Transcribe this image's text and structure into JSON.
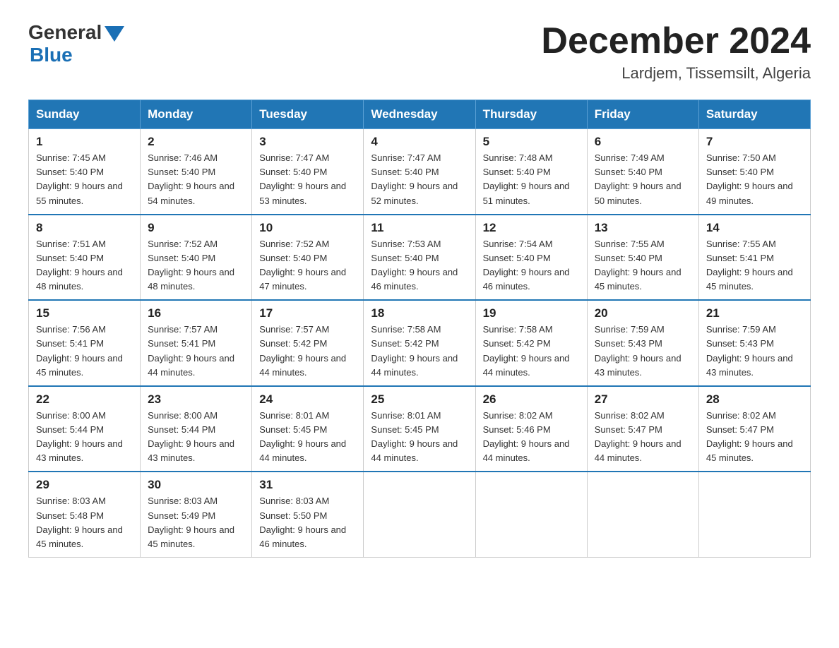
{
  "header": {
    "logo_general": "General",
    "logo_blue": "Blue",
    "month_title": "December 2024",
    "location": "Lardjem, Tissemsilt, Algeria"
  },
  "days_of_week": [
    "Sunday",
    "Monday",
    "Tuesday",
    "Wednesday",
    "Thursday",
    "Friday",
    "Saturday"
  ],
  "weeks": [
    [
      {
        "day": "1",
        "sunrise": "7:45 AM",
        "sunset": "5:40 PM",
        "daylight": "9 hours and 55 minutes."
      },
      {
        "day": "2",
        "sunrise": "7:46 AM",
        "sunset": "5:40 PM",
        "daylight": "9 hours and 54 minutes."
      },
      {
        "day": "3",
        "sunrise": "7:47 AM",
        "sunset": "5:40 PM",
        "daylight": "9 hours and 53 minutes."
      },
      {
        "day": "4",
        "sunrise": "7:47 AM",
        "sunset": "5:40 PM",
        "daylight": "9 hours and 52 minutes."
      },
      {
        "day": "5",
        "sunrise": "7:48 AM",
        "sunset": "5:40 PM",
        "daylight": "9 hours and 51 minutes."
      },
      {
        "day": "6",
        "sunrise": "7:49 AM",
        "sunset": "5:40 PM",
        "daylight": "9 hours and 50 minutes."
      },
      {
        "day": "7",
        "sunrise": "7:50 AM",
        "sunset": "5:40 PM",
        "daylight": "9 hours and 49 minutes."
      }
    ],
    [
      {
        "day": "8",
        "sunrise": "7:51 AM",
        "sunset": "5:40 PM",
        "daylight": "9 hours and 48 minutes."
      },
      {
        "day": "9",
        "sunrise": "7:52 AM",
        "sunset": "5:40 PM",
        "daylight": "9 hours and 48 minutes."
      },
      {
        "day": "10",
        "sunrise": "7:52 AM",
        "sunset": "5:40 PM",
        "daylight": "9 hours and 47 minutes."
      },
      {
        "day": "11",
        "sunrise": "7:53 AM",
        "sunset": "5:40 PM",
        "daylight": "9 hours and 46 minutes."
      },
      {
        "day": "12",
        "sunrise": "7:54 AM",
        "sunset": "5:40 PM",
        "daylight": "9 hours and 46 minutes."
      },
      {
        "day": "13",
        "sunrise": "7:55 AM",
        "sunset": "5:40 PM",
        "daylight": "9 hours and 45 minutes."
      },
      {
        "day": "14",
        "sunrise": "7:55 AM",
        "sunset": "5:41 PM",
        "daylight": "9 hours and 45 minutes."
      }
    ],
    [
      {
        "day": "15",
        "sunrise": "7:56 AM",
        "sunset": "5:41 PM",
        "daylight": "9 hours and 45 minutes."
      },
      {
        "day": "16",
        "sunrise": "7:57 AM",
        "sunset": "5:41 PM",
        "daylight": "9 hours and 44 minutes."
      },
      {
        "day": "17",
        "sunrise": "7:57 AM",
        "sunset": "5:42 PM",
        "daylight": "9 hours and 44 minutes."
      },
      {
        "day": "18",
        "sunrise": "7:58 AM",
        "sunset": "5:42 PM",
        "daylight": "9 hours and 44 minutes."
      },
      {
        "day": "19",
        "sunrise": "7:58 AM",
        "sunset": "5:42 PM",
        "daylight": "9 hours and 44 minutes."
      },
      {
        "day": "20",
        "sunrise": "7:59 AM",
        "sunset": "5:43 PM",
        "daylight": "9 hours and 43 minutes."
      },
      {
        "day": "21",
        "sunrise": "7:59 AM",
        "sunset": "5:43 PM",
        "daylight": "9 hours and 43 minutes."
      }
    ],
    [
      {
        "day": "22",
        "sunrise": "8:00 AM",
        "sunset": "5:44 PM",
        "daylight": "9 hours and 43 minutes."
      },
      {
        "day": "23",
        "sunrise": "8:00 AM",
        "sunset": "5:44 PM",
        "daylight": "9 hours and 43 minutes."
      },
      {
        "day": "24",
        "sunrise": "8:01 AM",
        "sunset": "5:45 PM",
        "daylight": "9 hours and 44 minutes."
      },
      {
        "day": "25",
        "sunrise": "8:01 AM",
        "sunset": "5:45 PM",
        "daylight": "9 hours and 44 minutes."
      },
      {
        "day": "26",
        "sunrise": "8:02 AM",
        "sunset": "5:46 PM",
        "daylight": "9 hours and 44 minutes."
      },
      {
        "day": "27",
        "sunrise": "8:02 AM",
        "sunset": "5:47 PM",
        "daylight": "9 hours and 44 minutes."
      },
      {
        "day": "28",
        "sunrise": "8:02 AM",
        "sunset": "5:47 PM",
        "daylight": "9 hours and 45 minutes."
      }
    ],
    [
      {
        "day": "29",
        "sunrise": "8:03 AM",
        "sunset": "5:48 PM",
        "daylight": "9 hours and 45 minutes."
      },
      {
        "day": "30",
        "sunrise": "8:03 AM",
        "sunset": "5:49 PM",
        "daylight": "9 hours and 45 minutes."
      },
      {
        "day": "31",
        "sunrise": "8:03 AM",
        "sunset": "5:50 PM",
        "daylight": "9 hours and 46 minutes."
      },
      null,
      null,
      null,
      null
    ]
  ]
}
